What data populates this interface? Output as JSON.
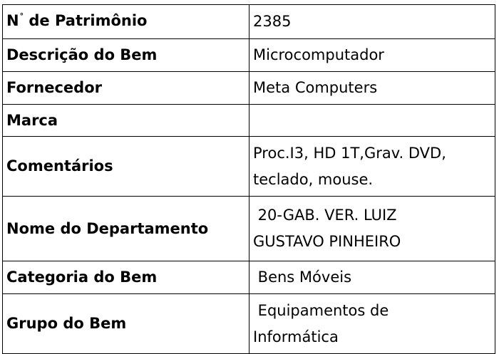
{
  "rows": [
    {
      "label_main": "N",
      "label_sup": "°",
      "label_rest": " de Patrimônio",
      "value": "2385"
    },
    {
      "label": "Descrição do Bem",
      "value": "Microcomputador"
    },
    {
      "label": "Fornecedor",
      "value": "Meta Computers"
    },
    {
      "label": "Marca",
      "value": ""
    },
    {
      "label": "Comentários",
      "value_line1": "Proc.I3, HD 1T,Grav. DVD,",
      "value_line2": "teclado, mouse."
    },
    {
      "label": "Nome do Departamento",
      "value_line1": " 20-GAB. VER. LUIZ",
      "value_line2": "GUSTAVO PINHEIRO"
    },
    {
      "label": "Categoria do Bem",
      "value": " Bens Móveis"
    },
    {
      "label": "Grupo do Bem",
      "value_line1": " Equipamentos de",
      "value_line2": "Informática"
    }
  ]
}
